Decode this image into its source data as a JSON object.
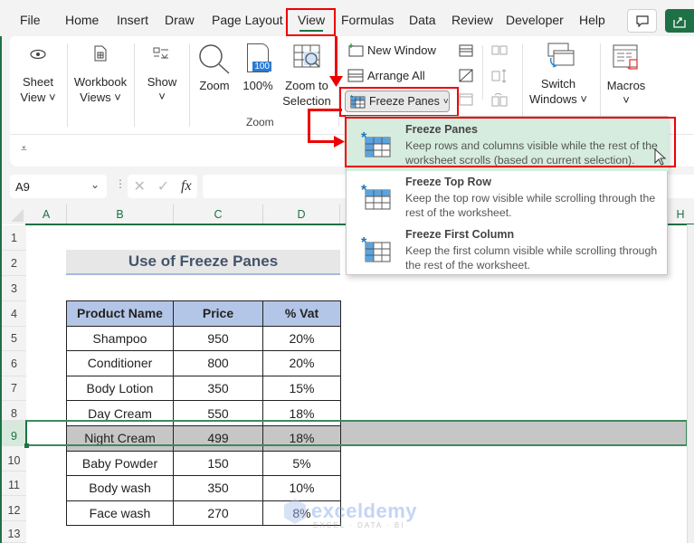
{
  "menu": {
    "tabs": [
      "File",
      "Home",
      "Insert",
      "Draw",
      "Page Layout",
      "View",
      "Formulas",
      "Data",
      "Review",
      "Developer",
      "Help"
    ],
    "active_tab": "View",
    "comment_icon": "comment-icon",
    "share_icon": "share-icon"
  },
  "ribbon": {
    "sheet_view": "Sheet View",
    "workbook_views": "Workbook Views",
    "show": "Show",
    "zoom": "Zoom",
    "zoom_100": "100%",
    "zoom_100_icon_text": "100",
    "zoom_to_selection": "Zoom to Selection",
    "zoom_group_label": "Zoom",
    "new_window": "New Window",
    "arrange_all": "Arrange All",
    "freeze_panes": "Freeze Panes",
    "switch_windows": "Switch Windows",
    "macros": "Macros"
  },
  "formula_bar": {
    "name_box": "A9",
    "fx_label": "fx",
    "formula_value": ""
  },
  "dropdown": {
    "items": [
      {
        "title": "Freeze Panes",
        "description": "Keep rows and columns visible while the rest of the worksheet scrolls (based on current selection).",
        "highlighted": true
      },
      {
        "title": "Freeze Top Row",
        "description": "Keep the top row visible while scrolling through the rest of the worksheet.",
        "highlighted": false
      },
      {
        "title": "Freeze First Column",
        "description": "Keep the first column visible while scrolling through the rest of the worksheet.",
        "highlighted": false
      }
    ]
  },
  "sheet": {
    "columns": [
      "A",
      "B",
      "C",
      "D",
      "H"
    ],
    "rows": [
      "1",
      "2",
      "3",
      "4",
      "5",
      "6",
      "7",
      "8",
      "9",
      "10",
      "11",
      "12",
      "13"
    ],
    "selected_row": "9",
    "title": "Use of Freeze Panes",
    "table": {
      "headers": [
        "Product Name",
        "Price",
        "% Vat"
      ],
      "rows": [
        [
          "Shampoo",
          "950",
          "20%"
        ],
        [
          "Conditioner",
          "800",
          "20%"
        ],
        [
          "Body Lotion",
          "350",
          "15%"
        ],
        [
          "Day Cream",
          "550",
          "18%"
        ],
        [
          "Night Cream",
          "499",
          "18%"
        ],
        [
          "Baby Powder",
          "150",
          "5%"
        ],
        [
          "Body wash",
          "350",
          "10%"
        ],
        [
          "Face wash",
          "270",
          "8%"
        ]
      ],
      "highlighted_row_index": 4
    }
  },
  "watermark": {
    "name": "exceldemy",
    "tagline": "EXCEL · DATA · BI"
  },
  "colors": {
    "excel_green": "#1e7145",
    "highlight_red": "#e00000",
    "header_blue": "#b4c6e7",
    "selected_gray": "#c6c6c6",
    "menu_hover_green": "#d5ecde"
  }
}
